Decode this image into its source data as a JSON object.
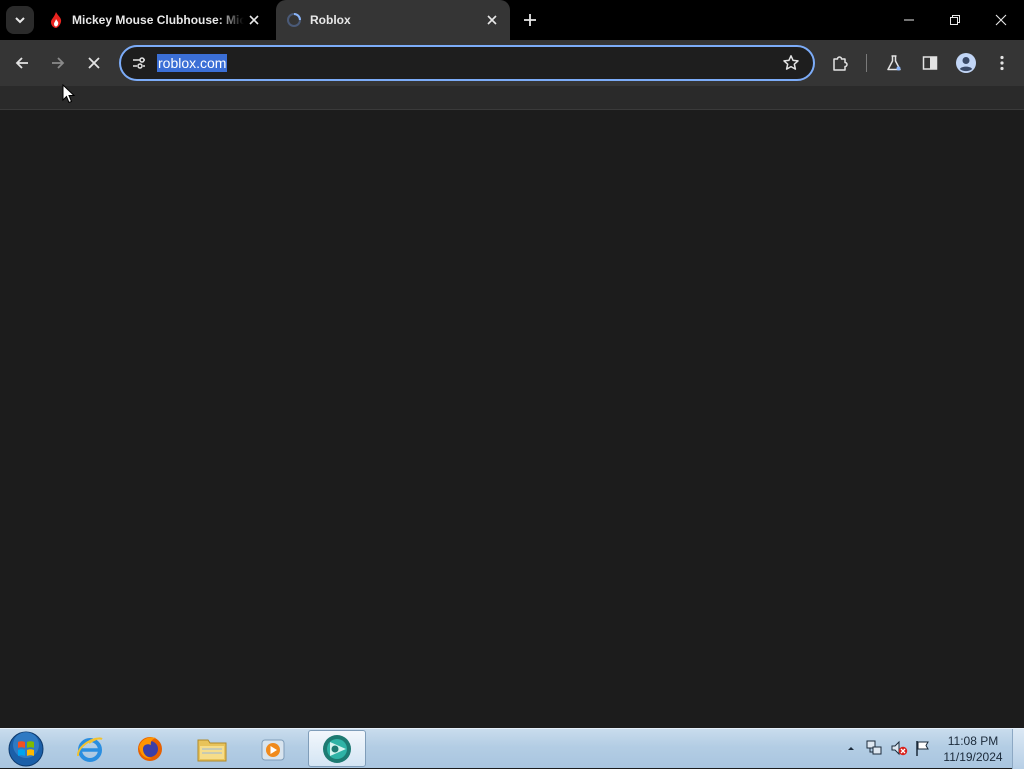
{
  "browser": {
    "tabs": [
      {
        "title": "Mickey Mouse Clubhouse: Mic",
        "favicon": "disney-flame-icon",
        "active": false
      },
      {
        "title": "Roblox",
        "favicon": "loading-spinner-icon",
        "active": true
      }
    ],
    "address_bar": {
      "url": "roblox.com",
      "selected": true
    },
    "loading": true
  },
  "taskbar": {
    "apps": [
      "internet-explorer-icon",
      "firefox-icon",
      "file-explorer-icon",
      "media-player-icon",
      "chrome-app-icon"
    ],
    "clock": {
      "time": "11:08 PM",
      "date": "11/19/2024"
    }
  },
  "colors": {
    "tabstrip": "#000000",
    "toolbar": "#353535",
    "page_background": "#1c1c1c",
    "url_selection": "#3b6fd6",
    "omnibox_focus": "#7cacf8"
  }
}
